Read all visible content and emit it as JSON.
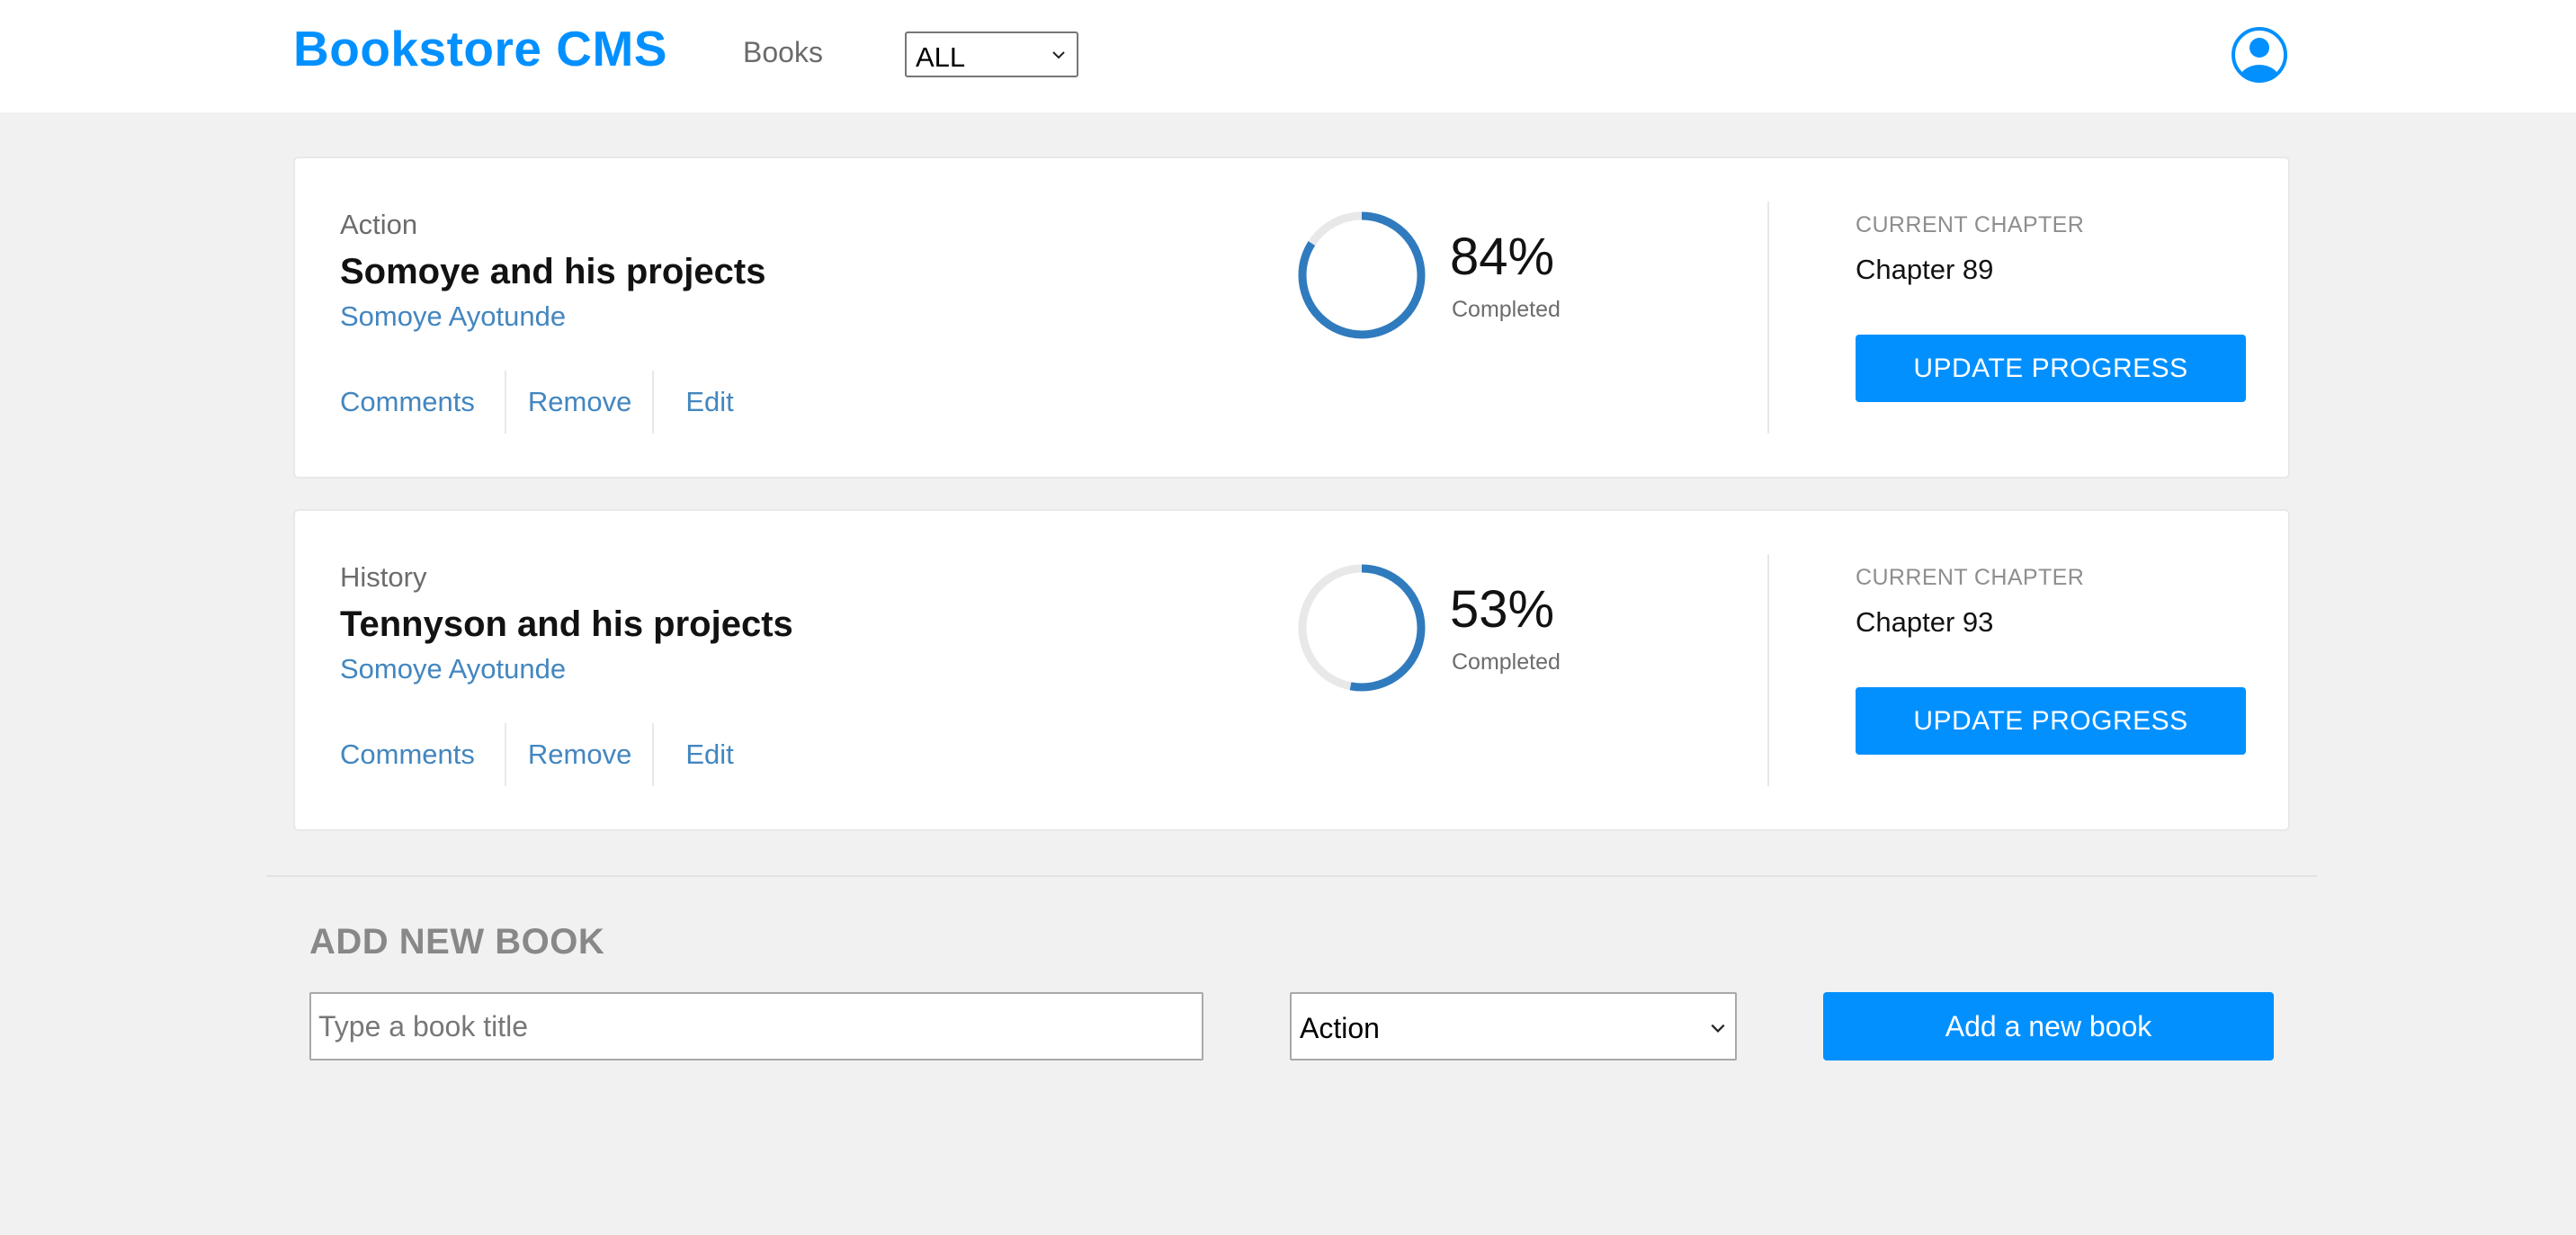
{
  "header": {
    "brand": "Bookstore CMS",
    "nav_books": "Books",
    "category_filter": {
      "selected": "ALL"
    },
    "avatar_icon": "user-circle-icon"
  },
  "colors": {
    "accent": "#0290ff",
    "link": "#4386bf",
    "background": "#f1f1f1",
    "ring_track": "#e8e8e8",
    "ring_progress": "#307bbe"
  },
  "books": [
    {
      "genre": "Action",
      "title": "Somoye and his projects",
      "author": "Somoye Ayotunde",
      "actions": {
        "comments": "Comments",
        "remove": "Remove",
        "edit": "Edit"
      },
      "progress_percent": 84,
      "percent_label": "84%",
      "completed_label": "Completed",
      "current_chapter_label": "CURRENT CHAPTER",
      "current_chapter": "Chapter 89",
      "update_label": "UPDATE PROGRESS"
    },
    {
      "genre": "History",
      "title": "Tennyson and his projects",
      "author": "Somoye Ayotunde",
      "actions": {
        "comments": "Comments",
        "remove": "Remove",
        "edit": "Edit"
      },
      "progress_percent": 53,
      "percent_label": "53%",
      "completed_label": "Completed",
      "current_chapter_label": "CURRENT CHAPTER",
      "current_chapter": "Chapter 93",
      "update_label": "UPDATE PROGRESS"
    }
  ],
  "add_book": {
    "heading": "ADD NEW BOOK",
    "title_placeholder": "Type a book title",
    "title_value": "",
    "category_selected": "Action",
    "submit_label": "Add a new book"
  }
}
